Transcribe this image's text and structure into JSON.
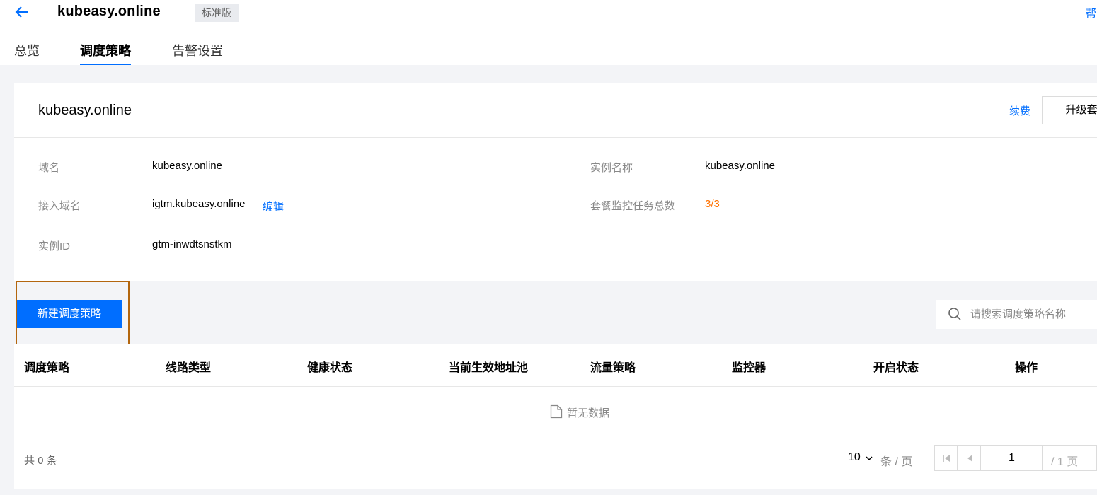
{
  "header": {
    "title": "kubeasy.online",
    "badge": "标准版",
    "help": "帮"
  },
  "tabs": [
    {
      "label": "总览",
      "active": false
    },
    {
      "label": "调度策略",
      "active": true
    },
    {
      "label": "告警设置",
      "active": false
    }
  ],
  "instance": {
    "title": "kubeasy.online",
    "renew": "续费",
    "upgrade": "升级套餐",
    "fields": {
      "domain_label": "域名",
      "domain_value": "kubeasy.online",
      "name_label": "实例名称",
      "name_value": "kubeasy.online",
      "access_label": "接入域名",
      "access_value": "igtm.kubeasy.online",
      "edit": "编辑",
      "quota_label": "套餐监控任务总数",
      "quota_value": "3/3",
      "id_label": "实例ID",
      "id_value": "gtm-inwdtsnstkm"
    }
  },
  "toolbar": {
    "new_button": "新建调度策略",
    "search_placeholder": "请搜索调度策略名称"
  },
  "table": {
    "columns": [
      "调度策略",
      "线路类型",
      "健康状态",
      "当前生效地址池",
      "流量策略",
      "监控器",
      "开启状态",
      "操作"
    ],
    "empty_text": "暂无数据"
  },
  "pagination": {
    "total": "共 0 条",
    "page_size": "10",
    "unit": "条 / 页",
    "current": "1",
    "total_pages": "/ 1 页"
  },
  "colors": {
    "accent": "#006eff",
    "quota": "#ff7200",
    "highlight_border": "#b3660e"
  }
}
